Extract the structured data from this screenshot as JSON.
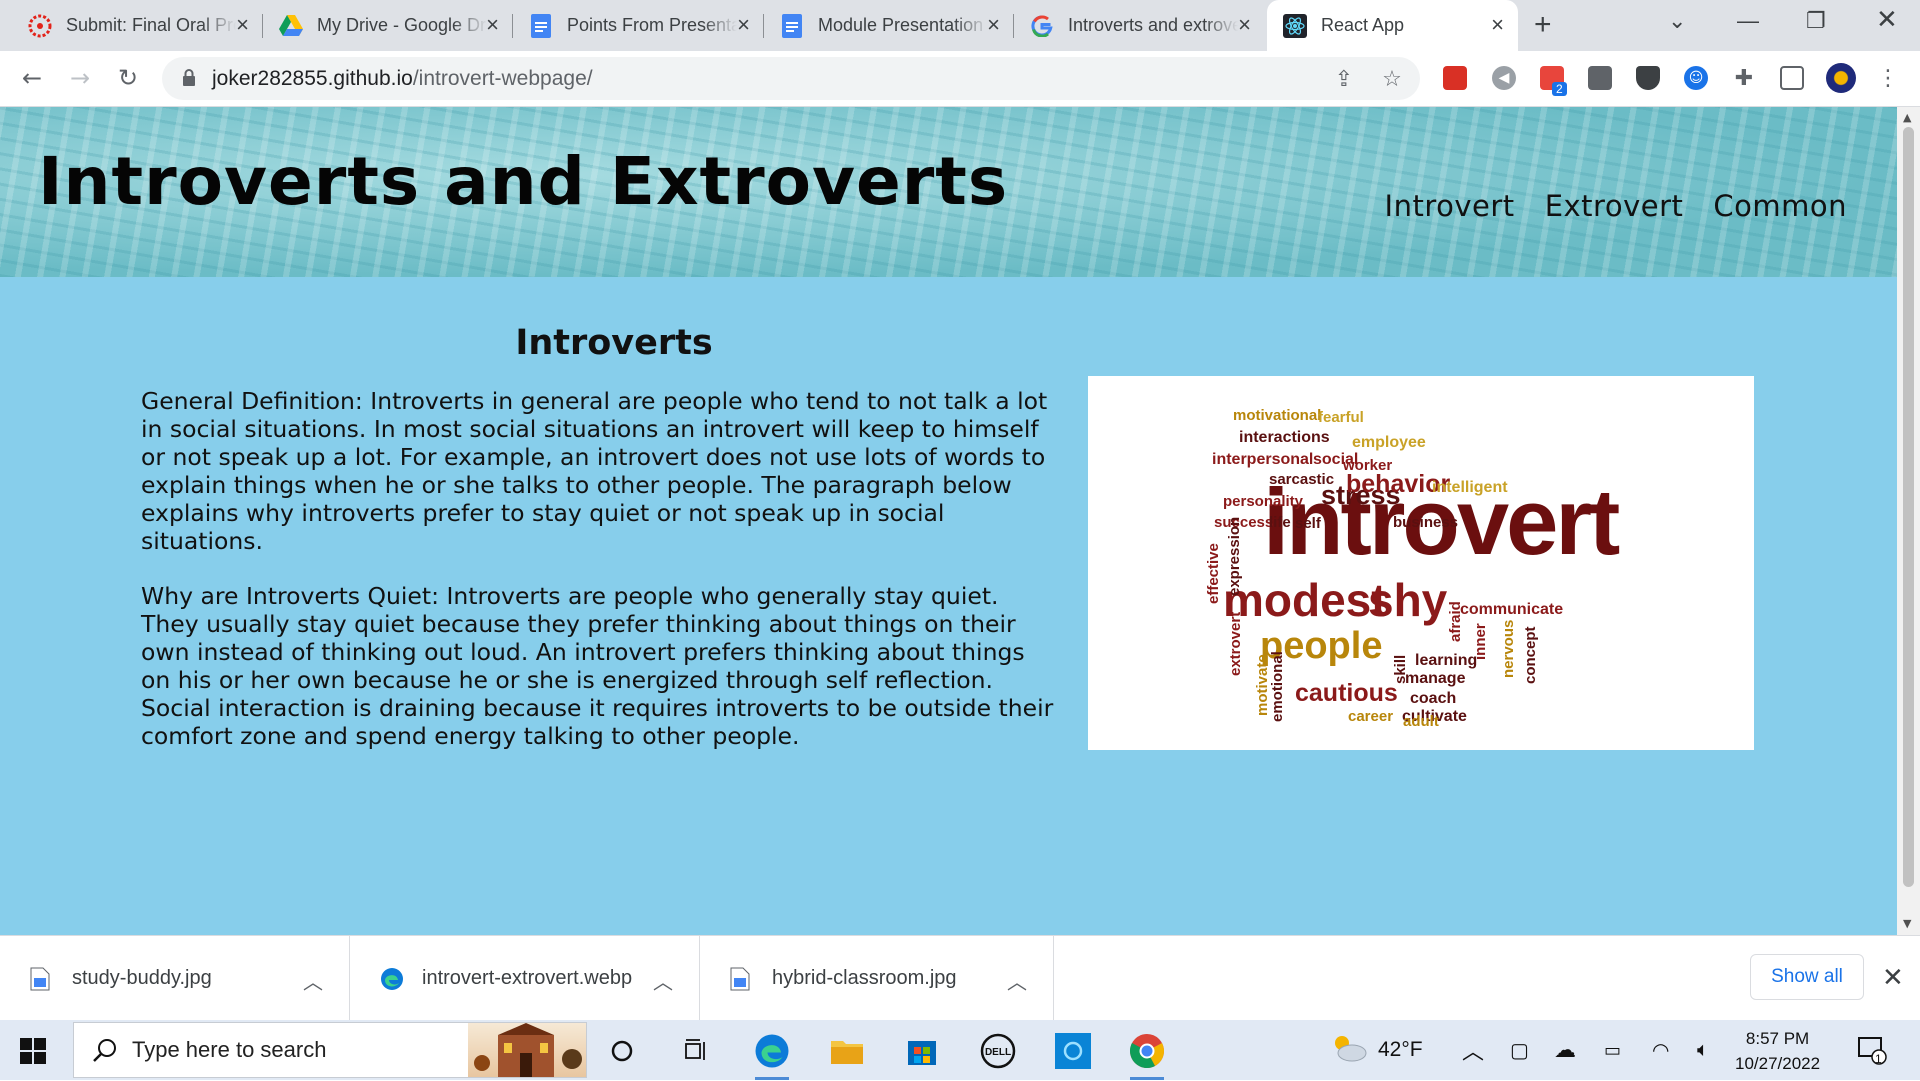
{
  "browser": {
    "tabs": [
      {
        "title": "Submit: Final Oral Presentation",
        "icon": "canvas-icon",
        "active": false
      },
      {
        "title": "My Drive - Google Drive",
        "icon": "google-drive-icon",
        "active": false
      },
      {
        "title": "Points From Presentation",
        "icon": "google-docs-icon",
        "active": false
      },
      {
        "title": "Module Presentation",
        "icon": "google-docs-icon",
        "active": false
      },
      {
        "title": "Introverts and extroverts",
        "icon": "google-icon",
        "active": false
      },
      {
        "title": "React App",
        "icon": "react-icon",
        "active": true
      }
    ],
    "url_host": "joker282855.github.io",
    "url_path": "/introvert-webpage/",
    "extension_badge": "2"
  },
  "page": {
    "title": "Introverts and Extroverts",
    "nav": [
      "Introvert",
      "Extrovert",
      "Common"
    ],
    "section_title": "Introverts",
    "paragraphs": [
      "General Definition: Introverts in general are people who tend to not talk a lot in social situations. In most social situations an introvert will keep to himself or not speak up a lot. For example, an introvert does not use lots of words to explain things when he or she talks to other people. The paragraph below explains why introverts prefer to stay quiet or not speak up in social situations.",
      "Why are Introverts Quiet: Introverts are people who generally stay quiet. They usually stay quiet because they prefer thinking about things on their own instead of thinking out loud. An introvert prefers thinking about things on his or her own because he or she is energized through self reflection. Social interaction is draining because it requires introverts to be outside their comfort zone and spend energy talking to other people."
    ],
    "word_cloud": [
      {
        "text": "introvert",
        "color": "#6b0f0f"
      },
      {
        "text": "modest",
        "color": "#8b1a1a"
      },
      {
        "text": "shy",
        "color": "#8b1a1a"
      },
      {
        "text": "people",
        "color": "#b8860b"
      },
      {
        "text": "stress",
        "color": "#5a1010"
      },
      {
        "text": "behavior",
        "color": "#8b1a1a"
      },
      {
        "text": "cautious",
        "color": "#8b1a1a"
      },
      {
        "text": "motivational",
        "color": "#b8860b"
      },
      {
        "text": "fearful",
        "color": "#c9a227"
      },
      {
        "text": "interactions",
        "color": "#5a1010"
      },
      {
        "text": "interpersonal",
        "color": "#8b1a1a"
      },
      {
        "text": "social",
        "color": "#8b1a1a"
      },
      {
        "text": "employee",
        "color": "#c9a227"
      },
      {
        "text": "sarcastic",
        "color": "#5a1010"
      },
      {
        "text": "worker",
        "color": "#8b1a1a"
      },
      {
        "text": "intelligent",
        "color": "#c9a227"
      },
      {
        "text": "personality",
        "color": "#8b1a1a"
      },
      {
        "text": "success",
        "color": "#8b1a1a"
      },
      {
        "text": "life",
        "color": "#5a1010"
      },
      {
        "text": "self",
        "color": "#5a1010"
      },
      {
        "text": "business",
        "color": "#5a1010"
      },
      {
        "text": "effective",
        "color": "#8b1a1a"
      },
      {
        "text": "expression",
        "color": "#5a1010"
      },
      {
        "text": "communicate",
        "color": "#8b1a1a"
      },
      {
        "text": "afraid",
        "color": "#8b1a1a"
      },
      {
        "text": "inner",
        "color": "#8b1a1a"
      },
      {
        "text": "nervous",
        "color": "#b8860b"
      },
      {
        "text": "concept",
        "color": "#5a1010"
      },
      {
        "text": "extrovert",
        "color": "#8b1a1a"
      },
      {
        "text": "motivate",
        "color": "#b8860b"
      },
      {
        "text": "emotional",
        "color": "#5a1010"
      },
      {
        "text": "skill",
        "color": "#5a1010"
      },
      {
        "text": "learning",
        "color": "#5a1010"
      },
      {
        "text": "manage",
        "color": "#5a1010"
      },
      {
        "text": "coach",
        "color": "#5a1010"
      },
      {
        "text": "cultivate",
        "color": "#5a1010"
      },
      {
        "text": "career",
        "color": "#b8860b"
      },
      {
        "text": "adult",
        "color": "#b8860b"
      }
    ],
    "header_text_color": "#050505",
    "body_bg_color": "#87ceeb"
  },
  "downloads": {
    "items": [
      {
        "name": "study-buddy.jpg",
        "icon": "image-file-icon"
      },
      {
        "name": "introvert-extrovert.webp",
        "icon": "edge-icon"
      },
      {
        "name": "hybrid-classroom.jpg",
        "icon": "image-file-icon"
      }
    ],
    "show_all": "Show all"
  },
  "taskbar": {
    "search_placeholder": "Type here to search",
    "weather": "42°F",
    "time": "8:57 PM",
    "date": "10/27/2022",
    "notification_count": "1"
  }
}
